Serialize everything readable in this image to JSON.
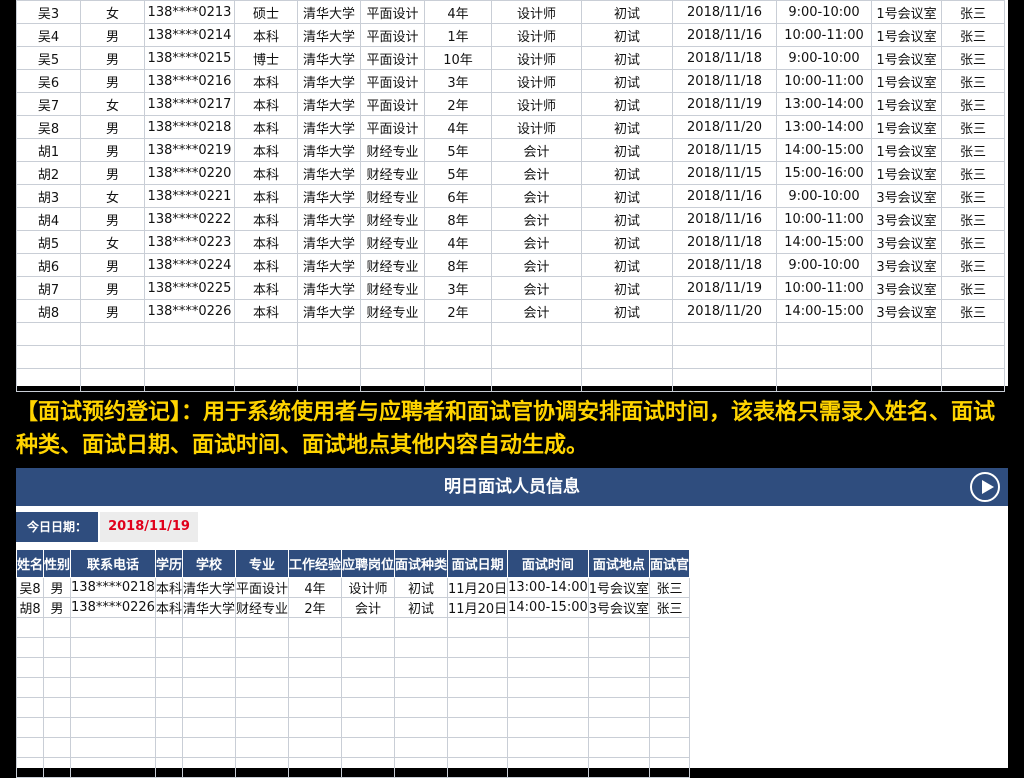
{
  "top_table": {
    "rows": [
      [
        "吴3",
        "女",
        "138****0213",
        "硕士",
        "清华大学",
        "平面设计",
        "4年",
        "设计师",
        "初试",
        "2018/11/16",
        "9:00-10:00",
        "1号会议室",
        "张三"
      ],
      [
        "吴4",
        "男",
        "138****0214",
        "本科",
        "清华大学",
        "平面设计",
        "1年",
        "设计师",
        "初试",
        "2018/11/16",
        "10:00-11:00",
        "1号会议室",
        "张三"
      ],
      [
        "吴5",
        "男",
        "138****0215",
        "博士",
        "清华大学",
        "平面设计",
        "10年",
        "设计师",
        "初试",
        "2018/11/18",
        "9:00-10:00",
        "1号会议室",
        "张三"
      ],
      [
        "吴6",
        "男",
        "138****0216",
        "本科",
        "清华大学",
        "平面设计",
        "3年",
        "设计师",
        "初试",
        "2018/11/18",
        "10:00-11:00",
        "1号会议室",
        "张三"
      ],
      [
        "吴7",
        "女",
        "138****0217",
        "本科",
        "清华大学",
        "平面设计",
        "2年",
        "设计师",
        "初试",
        "2018/11/19",
        "13:00-14:00",
        "1号会议室",
        "张三"
      ],
      [
        "吴8",
        "男",
        "138****0218",
        "本科",
        "清华大学",
        "平面设计",
        "4年",
        "设计师",
        "初试",
        "2018/11/20",
        "13:00-14:00",
        "1号会议室",
        "张三"
      ],
      [
        "胡1",
        "男",
        "138****0219",
        "本科",
        "清华大学",
        "财经专业",
        "5年",
        "会计",
        "初试",
        "2018/11/15",
        "14:00-15:00",
        "1号会议室",
        "张三"
      ],
      [
        "胡2",
        "男",
        "138****0220",
        "本科",
        "清华大学",
        "财经专业",
        "5年",
        "会计",
        "初试",
        "2018/11/15",
        "15:00-16:00",
        "1号会议室",
        "张三"
      ],
      [
        "胡3",
        "女",
        "138****0221",
        "本科",
        "清华大学",
        "财经专业",
        "6年",
        "会计",
        "初试",
        "2018/11/16",
        "9:00-10:00",
        "3号会议室",
        "张三"
      ],
      [
        "胡4",
        "男",
        "138****0222",
        "本科",
        "清华大学",
        "财经专业",
        "8年",
        "会计",
        "初试",
        "2018/11/16",
        "10:00-11:00",
        "3号会议室",
        "张三"
      ],
      [
        "胡5",
        "女",
        "138****0223",
        "本科",
        "清华大学",
        "财经专业",
        "4年",
        "会计",
        "初试",
        "2018/11/18",
        "14:00-15:00",
        "3号会议室",
        "张三"
      ],
      [
        "胡6",
        "男",
        "138****0224",
        "本科",
        "清华大学",
        "财经专业",
        "8年",
        "会计",
        "初试",
        "2018/11/18",
        "9:00-10:00",
        "3号会议室",
        "张三"
      ],
      [
        "胡7",
        "男",
        "138****0225",
        "本科",
        "清华大学",
        "财经专业",
        "3年",
        "会计",
        "初试",
        "2018/11/19",
        "10:00-11:00",
        "3号会议室",
        "张三"
      ],
      [
        "胡8",
        "男",
        "138****0226",
        "本科",
        "清华大学",
        "财经专业",
        "2年",
        "会计",
        "初试",
        "2018/11/20",
        "14:00-15:00",
        "3号会议室",
        "张三"
      ]
    ],
    "empty_rows": 3
  },
  "caption": "【面试预约登记】：用于系统使用者与应聘者和面试官协调安排面试时间，该表格只需录入姓名、面试种类、面试日期、面试时间、面试地点其他内容自动生成。",
  "panel": {
    "title": "明日面试人员信息",
    "play_icon": "play-circle-icon",
    "date_label": "今日日期：",
    "date_value": "2018/11/19",
    "headers": [
      "姓名",
      "性别",
      "联系电话",
      "学历",
      "学校",
      "专业",
      "工作经验",
      "应聘岗位",
      "面试种类",
      "面试日期",
      "面试时间",
      "面试地点",
      "面试官"
    ],
    "rows": [
      [
        "吴8",
        "男",
        "138****0218",
        "本科",
        "清华大学",
        "平面设计",
        "4年",
        "设计师",
        "初试",
        "11月20日",
        "13:00-14:00",
        "1号会议室",
        "张三"
      ],
      [
        "胡8",
        "男",
        "138****0226",
        "本科",
        "清华大学",
        "财经专业",
        "2年",
        "会计",
        "初试",
        "11月20日",
        "14:00-15:00",
        "3号会议室",
        "张三"
      ]
    ],
    "empty_rows": 8
  },
  "colors": {
    "header_bg": "#2f4d7e",
    "caption": "#ffd400",
    "date_value": "#e0001b"
  }
}
